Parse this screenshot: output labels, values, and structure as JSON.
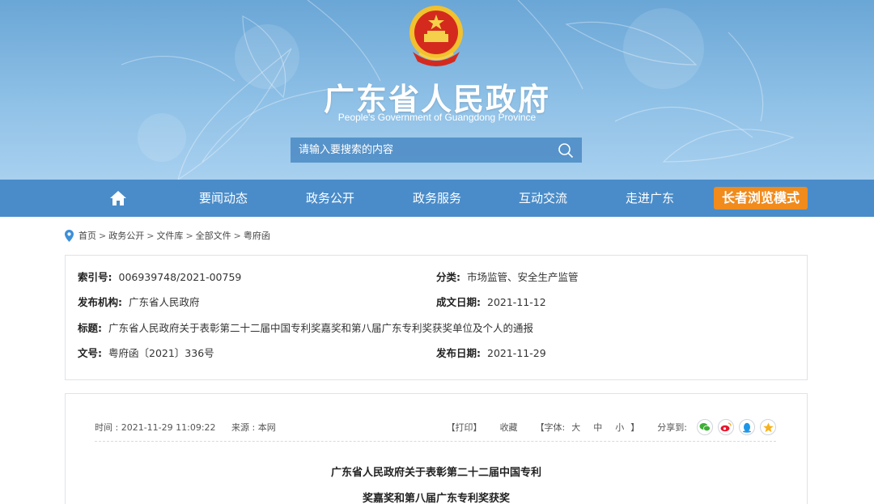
{
  "header": {
    "title": "广东省人民政府",
    "subtitle": "People's Government of Guangdong Province",
    "search_placeholder": "请输入要搜索的内容",
    "emblem_icon": "national-emblem",
    "search_icon": "magnifier"
  },
  "nav": {
    "home_icon": "home",
    "items": [
      "要闻动态",
      "政务公开",
      "政务服务",
      "互动交流",
      "走进广东"
    ],
    "elder_mode": "长者浏览模式",
    "elder_color": "#f08b1c",
    "bar_color": "#4a8cc9"
  },
  "breadcrumb": {
    "icon": "location-pin",
    "items": [
      "首页",
      "政务公开",
      "文件库",
      "全部文件",
      "粤府函"
    ],
    "separator": ">"
  },
  "info": {
    "index_label": "索引号:",
    "index_value": "006939748/2021-00759",
    "category_label": "分类:",
    "category_value": "市场监管、安全生产监管",
    "issuer_label": "发布机构:",
    "issuer_value": "广东省人民政府",
    "created_label": "成文日期:",
    "created_value": "2021-11-12",
    "title_label": "标题:",
    "title_value": "广东省人民政府关于表彰第二十二届中国专利奖嘉奖和第八届广东专利奖获奖单位及个人的通报",
    "docno_label": "文号:",
    "docno_value": "粤府函〔2021〕336号",
    "published_label": "发布日期:",
    "published_value": "2021-11-29"
  },
  "article": {
    "time": "时间 : 2021-11-29 11:09:22",
    "source": "来源 : 本网",
    "print": "【打印】",
    "favorite": "收藏",
    "font_label": "【字体:",
    "font_large": "大",
    "font_medium": "中",
    "font_small": "小",
    "font_end": "】",
    "share_label": "分享到:",
    "share_icons": [
      "wechat",
      "weibo",
      "qq",
      "qzone"
    ],
    "title_line1": "广东省人民政府关于表彰第二十二届中国专利",
    "title_line2": "奖嘉奖和第八届广东专利奖获奖"
  }
}
